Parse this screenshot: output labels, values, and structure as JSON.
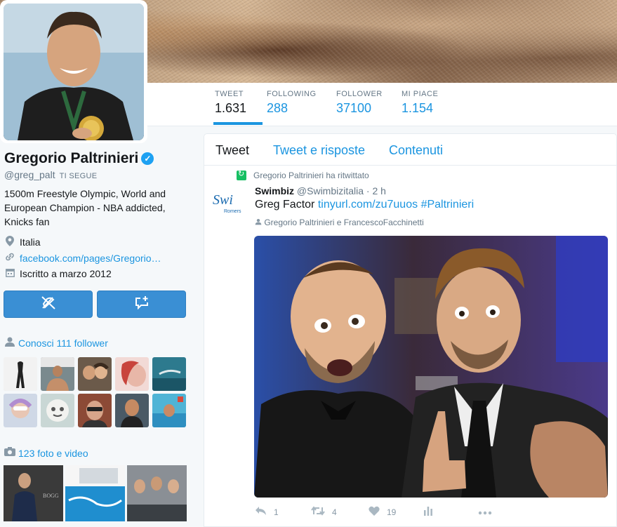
{
  "profile": {
    "name": "Gregorio Paltrinieri",
    "handle": "@greg_palt",
    "follows_you": "TI SEGUE",
    "bio": "1500m Freestyle Olympic, World and European Champion - NBA addicted, Knicks fan",
    "location": "Italia",
    "website": "facebook.com/pages/Gregorio…",
    "joined": "Iscritto a marzo 2012"
  },
  "nav": [
    {
      "label": "TWEET",
      "value": "1.631"
    },
    {
      "label": "FOLLOWING",
      "value": "288"
    },
    {
      "label": "FOLLOWER",
      "value": "37100"
    },
    {
      "label": "MI PIACE",
      "value": "1.154"
    }
  ],
  "followers_you_know": "Conosci 111 follower",
  "media_title": "123 foto e video",
  "tabs": [
    "Tweet",
    "Tweet e risposte",
    "Contenuti"
  ],
  "tweet": {
    "retweeted_by": "Gregorio Paltrinieri ha ritwittato",
    "author_name": "Swimbiz",
    "author_handle": "@Swimbizitalia",
    "time": "· 2 h",
    "text": "Greg Factor",
    "link": "tinyurl.com/zu7uuos",
    "hashtag": "#Paltrinieri",
    "tagged": "Gregorio Paltrinieri e FrancescoFacchinetti",
    "avatar_text": "Swi",
    "avatar_subtext": "Romers",
    "replies": "1",
    "retweets": "4",
    "likes": "19"
  },
  "colors": {
    "accent": "#1b95e0",
    "button": "#3a8fd4",
    "verified": "#1da1f2",
    "retweet": "#17bf63"
  }
}
